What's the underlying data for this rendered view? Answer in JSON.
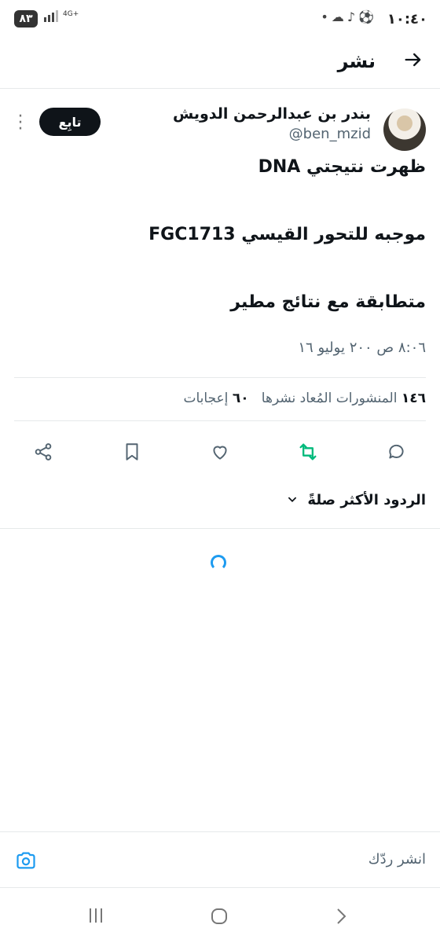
{
  "status_bar": {
    "battery": "٨٣",
    "network": "4G+",
    "time": "١٠:٤٠",
    "icons": [
      "signal-icon",
      "cloud-icon",
      "tiktok-icon",
      "football-icon",
      "dot-icon"
    ]
  },
  "header": {
    "title": "نشر",
    "back_icon": "arrow-right-icon"
  },
  "tweet": {
    "author_name": "بندر بن عبدالرحمن الدويش",
    "handle": "@ben_mzid",
    "follow_label": "تابِع",
    "lines": [
      "ظهرت نتيجتي DNA",
      "موجبه للتحور القيسي FGC1713",
      "متطابقة مع نتائج مطير"
    ],
    "timestamp": "٨:٠٦ ص ٢٠٠ يوليو ١٦",
    "reposts_count": "١٤٦",
    "reposts_label": "المنشورات المُعاد نشرها",
    "likes_count": "٦٠",
    "likes_label": "إعجابات"
  },
  "actions": [
    "reply-icon",
    "repost-icon",
    "like-icon",
    "bookmark-icon",
    "share-icon"
  ],
  "colors": {
    "repost": "#00ba7c",
    "accent": "#1d9bf0",
    "text": "#0f1419",
    "muted": "#536471"
  },
  "replies_sort": {
    "label": "الردود الأكثر صلةً"
  },
  "composer": {
    "placeholder": "انشر ردّك"
  }
}
